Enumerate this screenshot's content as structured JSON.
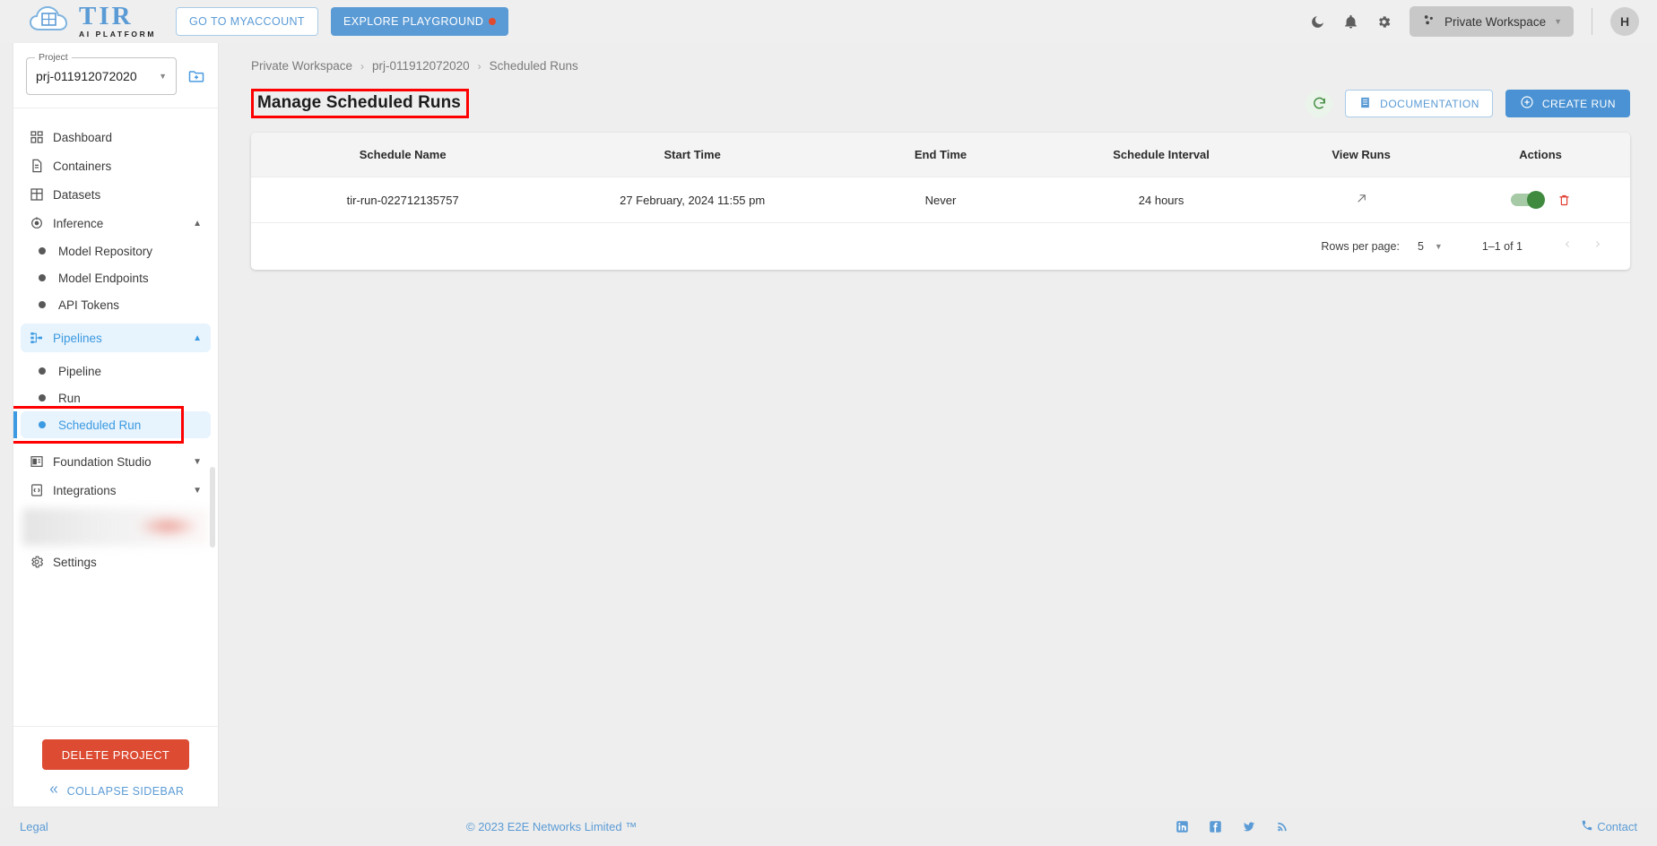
{
  "topbar": {
    "logo_title": "TIR",
    "logo_subtitle": "AI PLATFORM",
    "myaccount_label": "GO TO MYACCOUNT",
    "playground_label": "EXPLORE PLAYGROUND",
    "theme_icon": "moon-icon",
    "notification_icon": "bell-icon",
    "settings_icon": "gear-icon",
    "workspace_label": "Private Workspace",
    "workspace_icon": "workspace-nodes-icon",
    "avatar_initial": "H"
  },
  "sidebar": {
    "project_label": "Project",
    "project_value": "prj-011912072020",
    "new_project_icon": "folder-add-icon",
    "items": [
      {
        "label": "Dashboard",
        "icon": "dashboard-grid-icon",
        "type": "item"
      },
      {
        "label": "Containers",
        "icon": "document-icon",
        "type": "item"
      },
      {
        "label": "Datasets",
        "icon": "table-grid-icon",
        "type": "item"
      },
      {
        "label": "Inference",
        "icon": "inference-icon",
        "type": "group",
        "expanded": true
      },
      {
        "label": "Model Repository",
        "icon": "bullet",
        "type": "sub"
      },
      {
        "label": "Model Endpoints",
        "icon": "bullet",
        "type": "sub"
      },
      {
        "label": "API Tokens",
        "icon": "bullet",
        "type": "sub"
      },
      {
        "label": "Pipelines",
        "icon": "pipelines-icon",
        "type": "group",
        "expanded": true,
        "active": true
      },
      {
        "label": "Pipeline",
        "icon": "bullet",
        "type": "sub"
      },
      {
        "label": "Run",
        "icon": "bullet",
        "type": "sub"
      },
      {
        "label": "Scheduled Run",
        "icon": "bullet",
        "type": "sub",
        "selected": true
      },
      {
        "label": "Foundation Studio",
        "icon": "studio-icon",
        "type": "group",
        "expanded": false
      },
      {
        "label": "Integrations",
        "icon": "code-icon",
        "type": "group",
        "expanded": false
      },
      {
        "label": "Settings",
        "icon": "gear-icon",
        "type": "item"
      }
    ],
    "delete_project_label": "DELETE PROJECT",
    "collapse_label": "COLLAPSE SIDEBAR",
    "collapse_icon": "chevrons-left-icon"
  },
  "main": {
    "breadcrumb": [
      "Private Workspace",
      "prj-011912072020",
      "Scheduled Runs"
    ],
    "page_title": "Manage Scheduled Runs",
    "refresh_icon": "refresh-icon",
    "documentation_label": "DOCUMENTATION",
    "documentation_icon": "book-icon",
    "create_run_label": "CREATE RUN",
    "create_run_icon": "plus-circle-icon",
    "table": {
      "columns": [
        "Schedule Name",
        "Start Time",
        "End Time",
        "Schedule Interval",
        "View Runs",
        "Actions"
      ],
      "rows": [
        {
          "schedule_name": "tir-run-022712135757",
          "start_time": "27 February, 2024 11:55 pm",
          "end_time": "Never",
          "schedule_interval": "24 hours",
          "view_runs_icon": "arrow-up-right-icon",
          "toggle_on": true,
          "delete_icon": "trash-icon"
        }
      ]
    },
    "pagination": {
      "rows_per_page_label": "Rows per page:",
      "rows_per_page_value": "5",
      "range_label": "1–1 of 1",
      "prev_icon": "chevron-left-icon",
      "next_icon": "chevron-right-icon"
    }
  },
  "footer": {
    "legal": "Legal",
    "copyright": "© 2023 E2E Networks Limited ™",
    "socials": [
      "linkedin-icon",
      "facebook-icon",
      "twitter-icon",
      "rss-icon"
    ],
    "contact_label": "Contact",
    "contact_icon": "phone-icon"
  },
  "colors": {
    "accent": "#5b9bd5",
    "danger": "#dc4b32",
    "success": "#3f8a3f",
    "highlight_border": "#ff0000"
  }
}
